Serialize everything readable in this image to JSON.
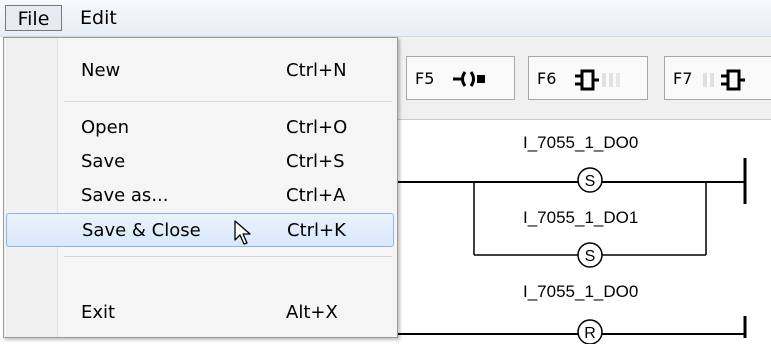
{
  "menubar": {
    "file_label": "File",
    "edit_label": "Edit"
  },
  "toolbar": {
    "f5_label": "F5",
    "f6_label": "F6",
    "f7_label": "F7"
  },
  "ladder": {
    "labels": [
      "I_7055_1_DO0",
      "I_7055_1_DO1",
      "I_7055_1_DO0"
    ],
    "coils": [
      "S",
      "S",
      "R"
    ]
  },
  "file_menu": {
    "items": [
      {
        "label": "New",
        "shortcut": "Ctrl+N"
      },
      {
        "label": "Open",
        "shortcut": "Ctrl+O"
      },
      {
        "label": "Save",
        "shortcut": "Ctrl+S"
      },
      {
        "label": "Save as...",
        "shortcut": "Ctrl+A"
      },
      {
        "label": "Save & Close",
        "shortcut": "Ctrl+K"
      },
      {
        "label": "Exit",
        "shortcut": "Alt+X"
      }
    ]
  }
}
